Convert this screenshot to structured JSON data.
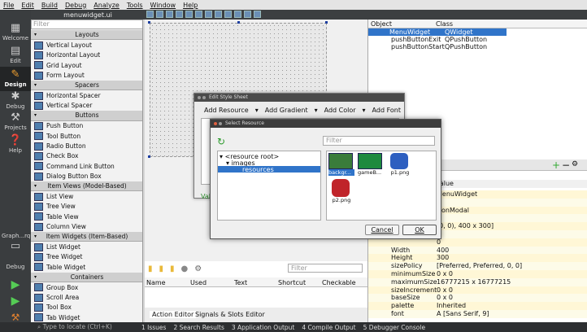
{
  "menu": [
    "File",
    "Edit",
    "Build",
    "Debug",
    "Analyze",
    "Tools",
    "Window",
    "Help"
  ],
  "toolbar": {
    "document": "menuwidget.ui"
  },
  "modes": {
    "welcome": "Welcome",
    "edit": "Edit",
    "design": "Design",
    "debug": "Debug",
    "projects": "Projects",
    "help": "Help",
    "kit": "Graph...rqui",
    "kit_debug": "Debug"
  },
  "widgetbox": {
    "filter": "Filter",
    "rows": [
      {
        "t": "cat",
        "l": "Layouts"
      },
      {
        "t": "item",
        "l": "Vertical Layout"
      },
      {
        "t": "item",
        "l": "Horizontal Layout"
      },
      {
        "t": "item",
        "l": "Grid Layout"
      },
      {
        "t": "item",
        "l": "Form Layout"
      },
      {
        "t": "cat",
        "l": "Spacers"
      },
      {
        "t": "item",
        "l": "Horizontal Spacer"
      },
      {
        "t": "item",
        "l": "Vertical Spacer"
      },
      {
        "t": "cat",
        "l": "Buttons"
      },
      {
        "t": "item",
        "l": "Push Button"
      },
      {
        "t": "item",
        "l": "Tool Button"
      },
      {
        "t": "item",
        "l": "Radio Button"
      },
      {
        "t": "item",
        "l": "Check Box"
      },
      {
        "t": "item",
        "l": "Command Link Button"
      },
      {
        "t": "item",
        "l": "Dialog Button Box"
      },
      {
        "t": "cat",
        "l": "Item Views (Model-Based)"
      },
      {
        "t": "item",
        "l": "List View"
      },
      {
        "t": "item",
        "l": "Tree View"
      },
      {
        "t": "item",
        "l": "Table View"
      },
      {
        "t": "item",
        "l": "Column View"
      },
      {
        "t": "cat",
        "l": "Item Widgets (Item-Based)"
      },
      {
        "t": "item",
        "l": "List Widget"
      },
      {
        "t": "item",
        "l": "Tree Widget"
      },
      {
        "t": "item",
        "l": "Table Widget"
      },
      {
        "t": "cat",
        "l": "Containers"
      },
      {
        "t": "item",
        "l": "Group Box"
      },
      {
        "t": "item",
        "l": "Scroll Area"
      },
      {
        "t": "item",
        "l": "Tool Box"
      },
      {
        "t": "item",
        "l": "Tab Widget"
      }
    ]
  },
  "action_editor": {
    "filter": "Filter",
    "columns": [
      "Name",
      "Used",
      "Text",
      "Shortcut",
      "Checkable"
    ],
    "tabs": [
      "Action Editor",
      "Signals & Slots Editor"
    ]
  },
  "object_inspector": {
    "headers": [
      "Object",
      "Class"
    ],
    "rows": [
      [
        "MenuWidget",
        "QWidget"
      ],
      [
        "pushButtonExit",
        "QPushButton"
      ],
      [
        "pushButtonStart",
        "QPushButton"
      ]
    ]
  },
  "property_editor": {
    "header_value": "Value",
    "rows": [
      [
        "",
        "MenuWidget"
      ],
      [
        "",
        ""
      ],
      [
        "",
        "NonModal"
      ],
      [
        "",
        "0"
      ],
      [
        "",
        "[0, 0), 400 x 300]"
      ],
      [
        "",
        "0"
      ],
      [
        "",
        "0"
      ],
      [
        "Width",
        "400"
      ],
      [
        "Height",
        "300"
      ],
      [
        "sizePolicy",
        "[Preferred, Preferred, 0, 0]"
      ],
      [
        "minimumSize",
        "0 x 0"
      ],
      [
        "maximumSize",
        "16777215 x 16777215"
      ],
      [
        "sizeIncrement",
        "0 x 0"
      ],
      [
        "baseSize",
        "0 x 0"
      ],
      [
        "palette",
        "Inherited"
      ],
      [
        "font",
        "A  [Sans Serif, 9]"
      ]
    ]
  },
  "style_dialog": {
    "title": "Edit Style Sheet",
    "actions": [
      "Add Resource",
      "Add Gradient",
      "Add Color",
      "Add Font"
    ],
    "valid": "Val"
  },
  "resource_dialog": {
    "title": "Select Resource",
    "filter": "Filter",
    "tree": [
      "<resource root>",
      "images",
      "resources"
    ],
    "files": [
      "backgr...",
      "gameB...",
      "p1.png",
      "p2.png"
    ],
    "cancel": "Cancel",
    "ok": "OK"
  },
  "statusbar": {
    "locate": "Type to locate (Ctrl+K)",
    "panes": [
      "1  Issues",
      "2  Search Results",
      "3  Application Output",
      "4  Compile Output",
      "5  Debugger Console"
    ]
  }
}
